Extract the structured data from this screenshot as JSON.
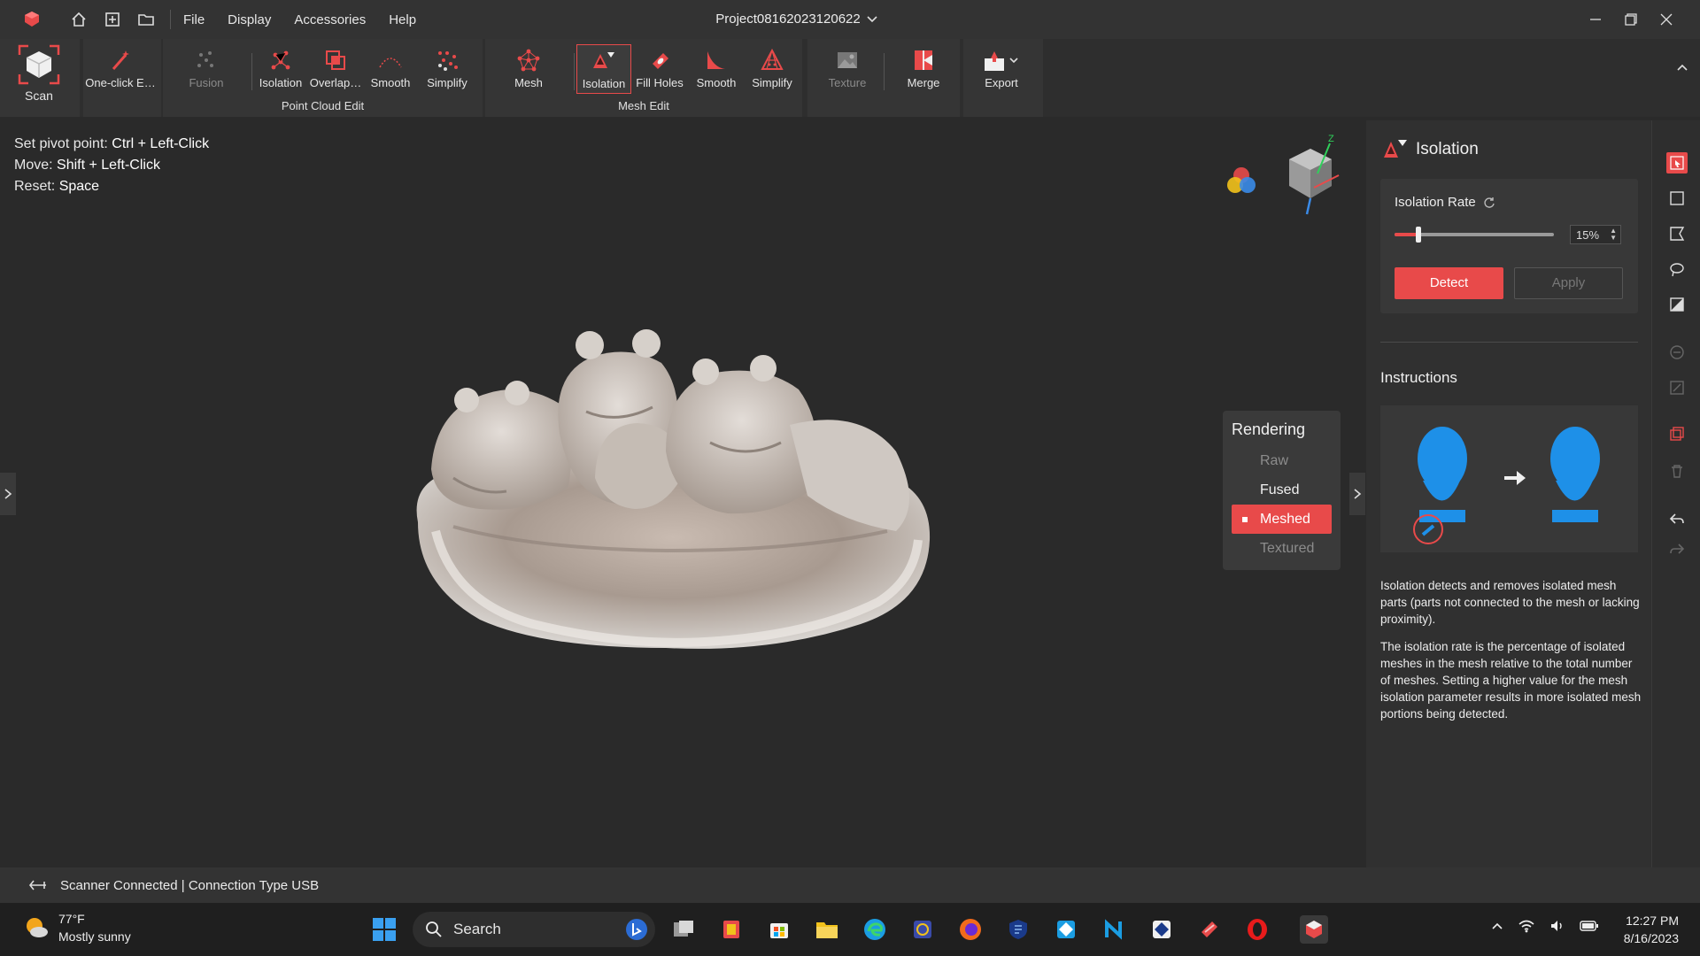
{
  "window": {
    "project_title": "Project08162023120622",
    "menu": [
      "File",
      "Display",
      "Accessories",
      "Help"
    ]
  },
  "toolbar": {
    "scan_label": "Scan",
    "one_click_label": "One-click E…",
    "point_cloud_group": "Point Cloud Edit",
    "point_cloud_tools": [
      "Fusion",
      "Isolation",
      "Overlap…",
      "Smooth",
      "Simplify"
    ],
    "mesh_group": "Mesh Edit",
    "mesh_tools": [
      "Mesh",
      "Isolation",
      "Fill Holes",
      "Smooth",
      "Simplify"
    ],
    "texture_label": "Texture",
    "merge_label": "Merge",
    "export_label": "Export"
  },
  "viewport": {
    "hints": [
      {
        "label": "Set pivot point:",
        "key": "Ctrl + Left-Click"
      },
      {
        "label": "Move:",
        "key": "Shift + Left-Click"
      },
      {
        "label": "Reset:",
        "key": "Space"
      }
    ],
    "axis_label": "Z",
    "rendering": {
      "title": "Rendering",
      "options": [
        "Raw",
        "Fused",
        "Meshed",
        "Textured"
      ],
      "selected": "Meshed"
    }
  },
  "panel": {
    "title": "Isolation",
    "rate_label": "Isolation Rate",
    "rate_value": "15%",
    "rate_fraction": 0.15,
    "detect_label": "Detect",
    "apply_label": "Apply",
    "instructions_title": "Instructions",
    "desc1": "Isolation detects and removes isolated mesh parts (parts not connected to the mesh or lacking proximity).",
    "desc2": "The isolation rate is the percentage of isolated meshes in the mesh relative to the total number of meshes. Setting a higher value for the mesh isolation parameter results in more isolated mesh portions being detected."
  },
  "status": {
    "text": "Scanner Connected | Connection Type USB"
  },
  "taskbar": {
    "weather_temp": "77°F",
    "weather_desc": "Mostly sunny",
    "search_label": "Search",
    "time": "12:27 PM",
    "date": "8/16/2023"
  },
  "colors": {
    "accent": "#e84a4a",
    "background": "#2a2a2a",
    "panel": "#303030"
  }
}
